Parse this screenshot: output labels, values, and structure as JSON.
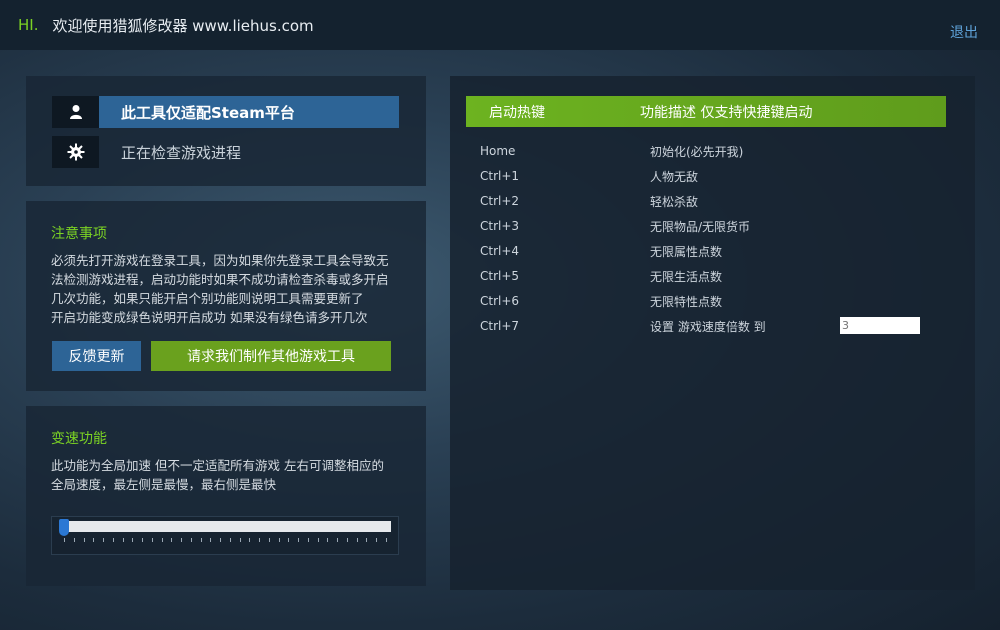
{
  "header": {
    "greeting": "HI.",
    "title": "欢迎使用猎狐修改器 www.liehus.com",
    "exit_label": "退出"
  },
  "status": {
    "platform_label": "此工具仅适配Steam平台",
    "process_label": "正在检查游戏进程"
  },
  "notice": {
    "title": "注意事项",
    "lines": [
      "必须先打开游戏在登录工具，因为如果你先登录工具会导致无",
      "法检测游戏进程，启动功能时如果不成功请检查杀毒或多开启",
      "几次功能，如果只能开启个别功能则说明工具需要更新了",
      "开启功能变成绿色说明开启成功 如果没有绿色请多开几次"
    ],
    "feedback_label": "反馈更新",
    "request_label": "请求我们制作其他游戏工具"
  },
  "speed": {
    "title": "变速功能",
    "lines": [
      "此功能为全局加速 但不一定适配所有游戏 左右可调整相应的",
      "全局速度，最左侧是最慢，最右侧是最快"
    ],
    "slider_level": 0
  },
  "hotkeys": {
    "col_key": "启动热键",
    "col_desc": "功能描述 仅支持快捷键启动",
    "rows": [
      {
        "key": "Home",
        "desc": "初始化(必先开我)"
      },
      {
        "key": "Ctrl+1",
        "desc": "人物无敌"
      },
      {
        "key": "Ctrl+2",
        "desc": "轻松杀敌"
      },
      {
        "key": "Ctrl+3",
        "desc": "无限物品/无限货币"
      },
      {
        "key": "Ctrl+4",
        "desc": "无限属性点数"
      },
      {
        "key": "Ctrl+5",
        "desc": "无限生活点数"
      },
      {
        "key": "Ctrl+6",
        "desc": "无限特性点数"
      },
      {
        "key": "Ctrl+7",
        "desc": "设置 游戏速度倍数 到"
      }
    ],
    "speed_multiplier_placeholder": "3"
  },
  "colors": {
    "accent_green": "#7bd224",
    "accent_blue": "#2d6496",
    "header_green": "#6db320"
  },
  "icons": {
    "user": "user-icon",
    "gear": "gear-icon"
  }
}
